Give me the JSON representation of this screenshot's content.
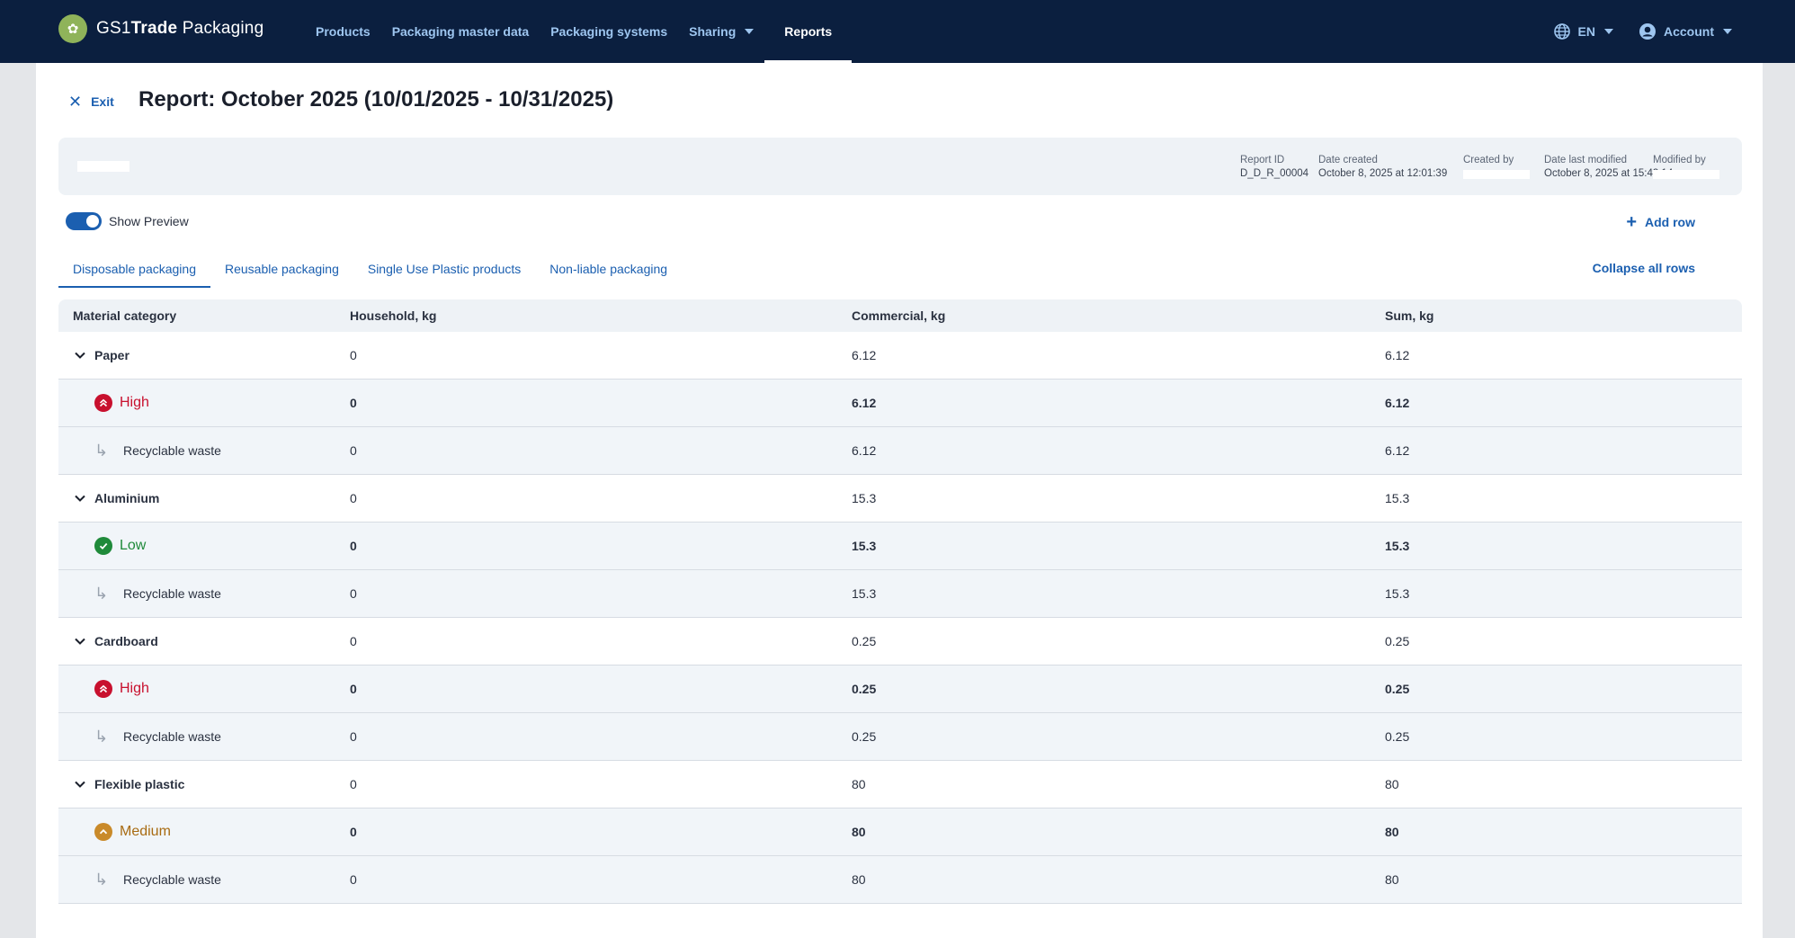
{
  "app": {
    "brand_prefix": "GS1",
    "brand_bold": "Trade",
    "brand_suffix": " Packaging"
  },
  "nav": {
    "items": [
      {
        "label": "Products"
      },
      {
        "label": "Packaging master data"
      },
      {
        "label": "Packaging systems"
      },
      {
        "label": "Sharing"
      },
      {
        "label": "Reports"
      }
    ],
    "language": "EN",
    "account": "Account"
  },
  "header": {
    "exit_label": "Exit",
    "title": "Report: October 2025 (10/01/2025 - 10/31/2025)"
  },
  "meta": {
    "report_id_label": "Report ID",
    "report_id": "D_D_R_00004",
    "date_created_label": "Date created",
    "date_created": "October 8, 2025 at 12:01:39",
    "created_by_label": "Created by",
    "date_modified_label": "Date last modified",
    "date_modified": "October 8, 2025 at 15:43:14",
    "modified_by_label": "Modified by"
  },
  "controls": {
    "show_preview_label": "Show Preview",
    "show_preview_on": true,
    "add_row_label": "Add row",
    "collapse_label": "Collapse all rows"
  },
  "tabs": [
    {
      "label": "Disposable packaging",
      "active": true
    },
    {
      "label": "Reusable packaging",
      "active": false
    },
    {
      "label": "Single Use Plastic products",
      "active": false
    },
    {
      "label": "Non-liable packaging",
      "active": false
    }
  ],
  "table": {
    "headers": [
      "Material category",
      "Household, kg",
      "Commercial, kg",
      "Sum, kg"
    ],
    "groups": [
      {
        "name": "Paper",
        "household": "0",
        "commercial": "6.12",
        "sum": "6.12",
        "level": {
          "label": "High",
          "color": "#c8102e",
          "icon": "double-chevron-up-icon"
        },
        "level_values": {
          "household": "0",
          "commercial": "6.12",
          "sum": "6.12"
        },
        "sub": {
          "label": "Recyclable waste",
          "household": "0",
          "commercial": "6.12",
          "sum": "6.12"
        }
      },
      {
        "name": "Aluminium",
        "household": "0",
        "commercial": "15.3",
        "sum": "15.3",
        "level": {
          "label": "Low",
          "color": "#1f8a3a",
          "icon": "check-icon"
        },
        "level_values": {
          "household": "0",
          "commercial": "15.3",
          "sum": "15.3"
        },
        "sub": {
          "label": "Recyclable waste",
          "household": "0",
          "commercial": "15.3",
          "sum": "15.3"
        }
      },
      {
        "name": "Cardboard",
        "household": "0",
        "commercial": "0.25",
        "sum": "0.25",
        "level": {
          "label": "High",
          "color": "#c8102e",
          "icon": "double-chevron-up-icon"
        },
        "level_values": {
          "household": "0",
          "commercial": "0.25",
          "sum": "0.25"
        },
        "sub": {
          "label": "Recyclable waste",
          "household": "0",
          "commercial": "0.25",
          "sum": "0.25"
        }
      },
      {
        "name": "Flexible plastic",
        "household": "0",
        "commercial": "80",
        "sum": "80",
        "level": {
          "label": "Medium",
          "color": "#a86b12",
          "icon": "chevron-up-icon"
        },
        "level_values": {
          "household": "0",
          "commercial": "80",
          "sum": "80"
        },
        "sub": {
          "label": "Recyclable waste",
          "household": "0",
          "commercial": "80",
          "sum": "80"
        }
      }
    ]
  }
}
